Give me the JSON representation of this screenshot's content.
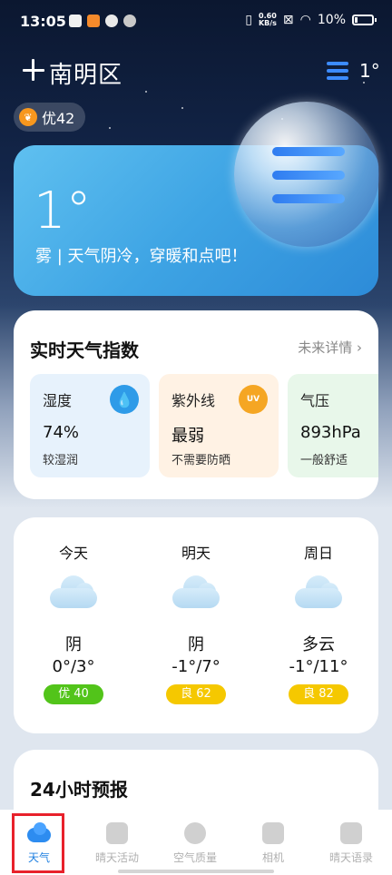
{
  "status_bar": {
    "time": "13:05",
    "net_speed_value": "0.60",
    "net_speed_unit": "KB/s",
    "battery": "10%"
  },
  "header": {
    "city": "南明区",
    "temp": "1°"
  },
  "aqi": {
    "label": "优42",
    "color": "#f7971e"
  },
  "now": {
    "temp": "1°",
    "description": "雾 | 天气阴冷，穿暖和点吧！"
  },
  "indices": {
    "title": "实时天气指数",
    "more": "未来详情 ›",
    "items": [
      {
        "label": "湿度",
        "value": "74%",
        "sub": "较湿润",
        "icon": "water-drop-icon",
        "bg": "#e7f2fc",
        "icon_color": "#2e9be8"
      },
      {
        "label": "紫外线",
        "value": "最弱",
        "sub": "不需要防晒",
        "icon": "uv-sun-icon",
        "icon_text": "UV",
        "bg": "#fff2e4",
        "icon_color": "#f5a623"
      },
      {
        "label": "气压",
        "value": "893hPa",
        "sub": "一般舒适",
        "icon": "pressure-gauge-icon",
        "bg": "#e8f7ea",
        "icon_color": "#4cc46a"
      }
    ]
  },
  "forecast": [
    {
      "day": "今天",
      "condition": "阴",
      "range": "0°/3°",
      "aqi": "优 40",
      "aqi_color": "#52c41a"
    },
    {
      "day": "明天",
      "condition": "阴",
      "range": "-1°/7°",
      "aqi": "良 62",
      "aqi_color": "#f5c800"
    },
    {
      "day": "周日",
      "condition": "多云",
      "range": "-1°/11°",
      "aqi": "良 82",
      "aqi_color": "#f5c800"
    }
  ],
  "hourly": {
    "title": "24小时预报"
  },
  "nav": [
    {
      "label": "天气",
      "icon": "weather-cloud-icon",
      "active": true
    },
    {
      "label": "晴天活动",
      "icon": "flag-icon",
      "active": false
    },
    {
      "label": "空气质量",
      "icon": "leaf-icon",
      "active": false
    },
    {
      "label": "相机",
      "icon": "camera-icon",
      "active": false
    },
    {
      "label": "晴天语录",
      "icon": "feather-icon",
      "active": false
    }
  ]
}
